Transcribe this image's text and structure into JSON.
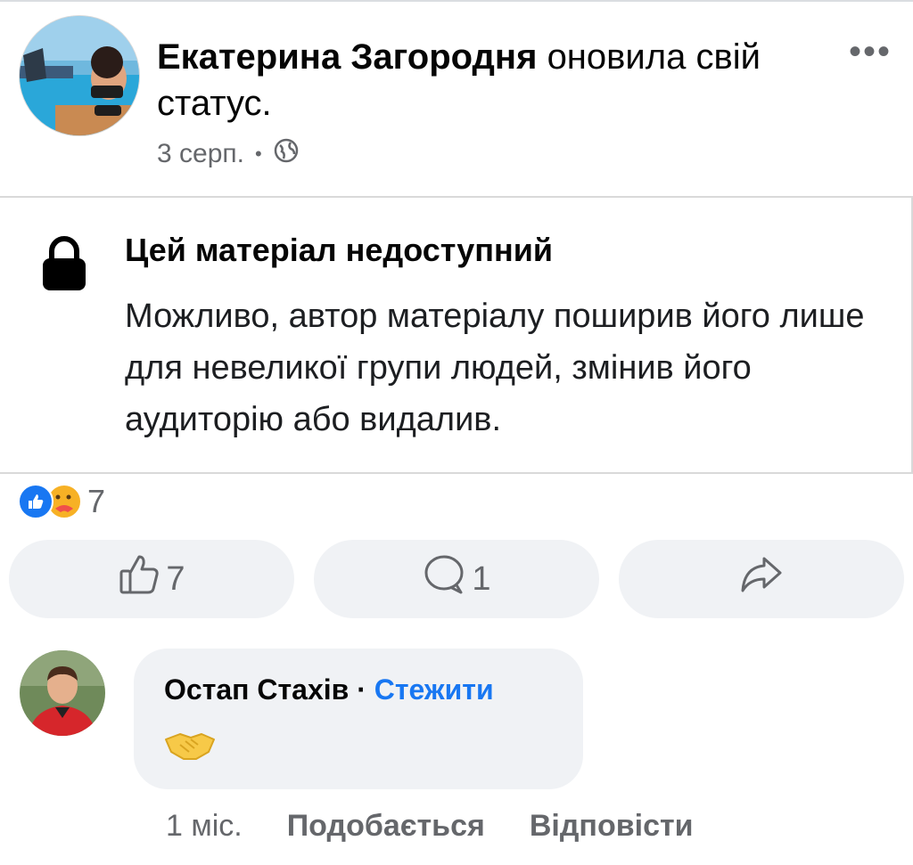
{
  "post": {
    "author": "Екатерина Загородня",
    "action": "оновила свій статус.",
    "date": "3 серп.",
    "more_icon": "more-horizontal-icon",
    "privacy_icon": "globe-icon"
  },
  "unavailable": {
    "title": "Цей матеріал недоступний",
    "body": "Можливо, автор матеріалу поширив його лише для невеликої групи людей, змінив його аудиторію або видалив.",
    "icon": "lock-icon"
  },
  "reactions": {
    "count": "7",
    "icons": [
      "like-reaction-icon",
      "care-reaction-icon"
    ]
  },
  "actions": {
    "like_count": "7",
    "comment_count": "1",
    "share_icon": "share-icon"
  },
  "comment": {
    "author": "Остап Стахів",
    "separator": "·",
    "follow": "Стежити",
    "content_emoji": "🤝",
    "time": "1 міс.",
    "like_label": "Подобається",
    "reply_label": "Відповісти"
  },
  "colors": {
    "accent": "#1877f2",
    "secondary_text": "#65676b",
    "pill_bg": "#f0f2f5"
  }
}
